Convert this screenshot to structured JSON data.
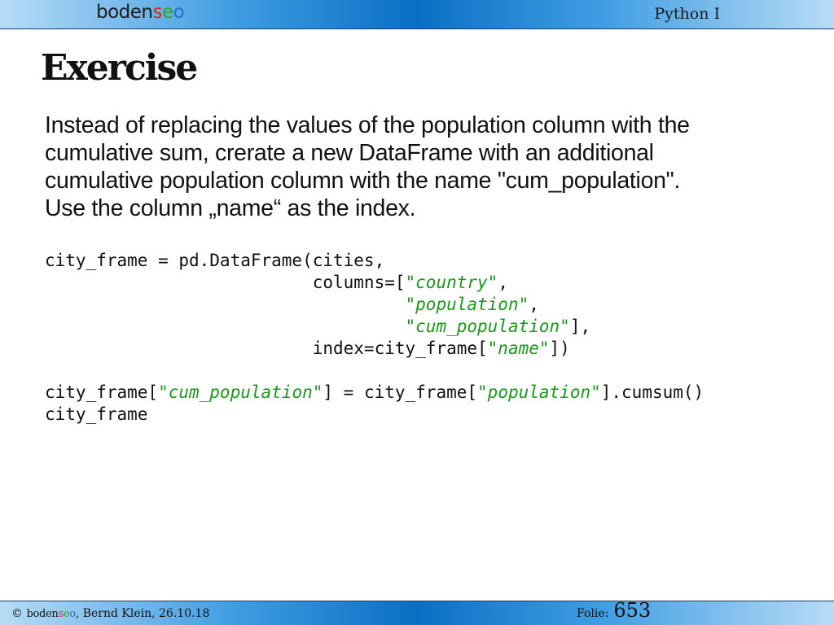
{
  "header": {
    "brand": {
      "part1": "boden",
      "part2": "s",
      "part3": "e",
      "part4": "o"
    },
    "course": "Python I"
  },
  "slide": {
    "title": "Exercise",
    "instructions": [
      "Instead of replacing the values of the population column with the",
      "cumulative sum, crerate a new DataFrame with an additional",
      "cumulative population column with the name \"cum_population\".",
      "Use the column „name“ as the index."
    ]
  },
  "code": {
    "l1": "city_frame = pd.DataFrame(cities,",
    "l2_pre": "                          columns=[",
    "l2_str": "\"country\"",
    "l2_post": ",",
    "l3_pre": "                                   ",
    "l3_str": "\"population\"",
    "l3_post": ",",
    "l4_pre": "                                   ",
    "l4_str": "\"cum_population\"",
    "l4_post": "],",
    "l5_pre": "                          index=city_frame[",
    "l5_str": "\"name\"",
    "l5_post": "])",
    "l6_pre": "city_frame[",
    "l6_str1": "\"cum_population\"",
    "l6_mid": "] = city_frame[",
    "l6_str2": "\"population\"",
    "l6_post": "].cumsum()",
    "l7": "city_frame"
  },
  "footer": {
    "copyright_prefix": "© ",
    "brand": {
      "part1": "boden",
      "part2": "s",
      "part3": "e",
      "part4": "o"
    },
    "author_date": ", Bernd Klein, 26.10.18",
    "folie_label": "Folie:",
    "folie_number": "653"
  },
  "colors": {
    "header_gradient": [
      "#b8dcf6",
      "#0a6fc4"
    ],
    "code_string": "#1a9a1a",
    "brand_red": "#d8262c",
    "brand_green": "#3d9b35",
    "brand_blue": "#2a6fc9"
  }
}
